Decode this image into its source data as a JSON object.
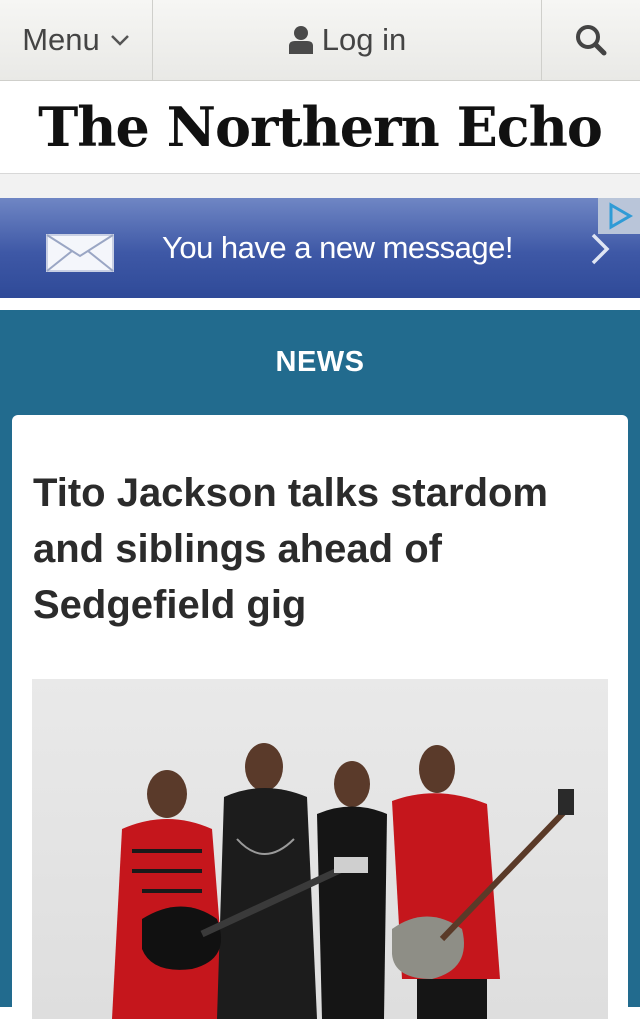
{
  "topbar": {
    "menu_label": "Menu",
    "login_label": "Log in",
    "icons": [
      "chevron-down-icon",
      "user-icon",
      "search-icon"
    ]
  },
  "masthead": {
    "logo_text": "The Northern Echo"
  },
  "ad_banner": {
    "text": "You have a new message!",
    "icons": [
      "envelope-icon",
      "chevron-right-icon",
      "ad-choices-icon"
    ],
    "colors": {
      "top": "#6f86c4",
      "bottom": "#2f4a98"
    }
  },
  "section": {
    "title": "NEWS",
    "background": "#226b8e"
  },
  "article": {
    "headline": "Tito Jackson talks stardom and siblings ahead of Sedgefield gig",
    "image_alt": "The Jacksons band photo"
  }
}
